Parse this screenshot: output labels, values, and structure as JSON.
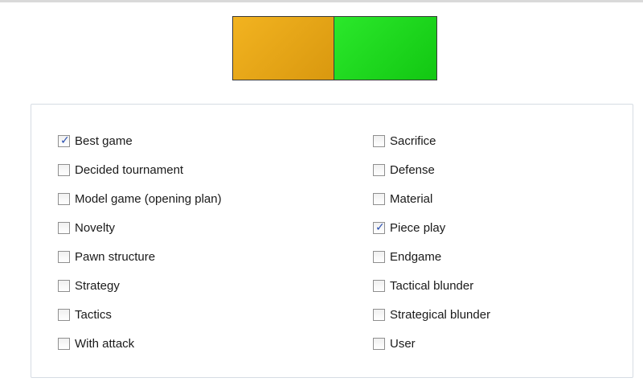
{
  "swatches": {
    "left_color": "#f2b320",
    "right_color": "#2be82b"
  },
  "options_left": [
    {
      "label": "Best game",
      "checked": true
    },
    {
      "label": "Decided tournament",
      "checked": false
    },
    {
      "label": "Model game (opening plan)",
      "checked": false
    },
    {
      "label": "Novelty",
      "checked": false
    },
    {
      "label": "Pawn structure",
      "checked": false
    },
    {
      "label": "Strategy",
      "checked": false
    },
    {
      "label": "Tactics",
      "checked": false
    },
    {
      "label": "With attack",
      "checked": false
    }
  ],
  "options_right": [
    {
      "label": "Sacrifice",
      "checked": false
    },
    {
      "label": "Defense",
      "checked": false
    },
    {
      "label": "Material",
      "checked": false
    },
    {
      "label": "Piece play",
      "checked": true
    },
    {
      "label": "Endgame",
      "checked": false
    },
    {
      "label": "Tactical blunder",
      "checked": false
    },
    {
      "label": "Strategical blunder",
      "checked": false
    },
    {
      "label": "User",
      "checked": false
    }
  ],
  "check_glyph": "✓",
  "colors": {
    "checkmark": "#2a4fb0",
    "panel_border": "#d6dce3"
  }
}
